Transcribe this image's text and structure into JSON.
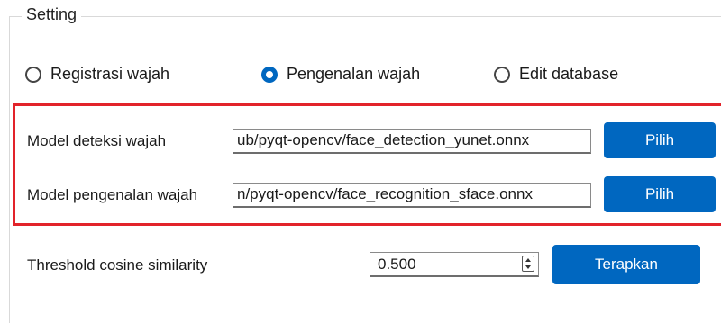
{
  "group": {
    "title": "Setting"
  },
  "mode": {
    "options": [
      {
        "label": "Registrasi wajah",
        "selected": false
      },
      {
        "label": "Pengenalan wajah",
        "selected": true
      },
      {
        "label": "Edit database",
        "selected": false
      }
    ]
  },
  "models": {
    "detection": {
      "label": "Model deteksi wajah",
      "path": "ub/pyqt-opencv/face_detection_yunet.onnx",
      "button": "Pilih"
    },
    "recognition": {
      "label": "Model pengenalan wajah",
      "path": "n/pyqt-opencv/face_recognition_sface.onnx",
      "button": "Pilih"
    }
  },
  "threshold": {
    "label": "Threshold cosine similarity",
    "value": "0.500",
    "button": "Terapkan"
  },
  "colors": {
    "accent": "#0067c0",
    "highlight_border": "#e2232a"
  }
}
